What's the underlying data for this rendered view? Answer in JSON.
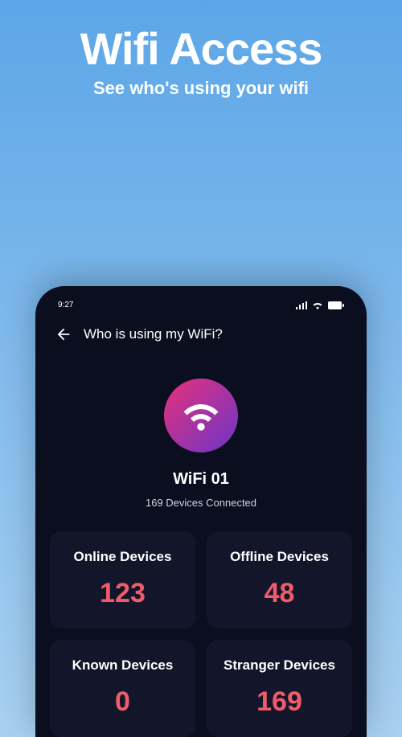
{
  "promo": {
    "title": "Wifi Access",
    "subtitle": "See who's using your wifi"
  },
  "statusBar": {
    "time": "9:27"
  },
  "header": {
    "title": "Who is using my WiFi?"
  },
  "wifi": {
    "name": "WiFi 01",
    "connectedText": "169 Devices Connected"
  },
  "cards": {
    "online": {
      "label": "Online Devices",
      "value": "123"
    },
    "offline": {
      "label": "Offline Devices",
      "value": "48"
    },
    "known": {
      "label": "Known Devices",
      "value": "0"
    },
    "stranger": {
      "label": "Stranger Devices",
      "value": "169"
    }
  },
  "colors": {
    "accent": "#f05c6a",
    "cardBg": "#13162b",
    "phoneBg": "#0b0e1f"
  }
}
